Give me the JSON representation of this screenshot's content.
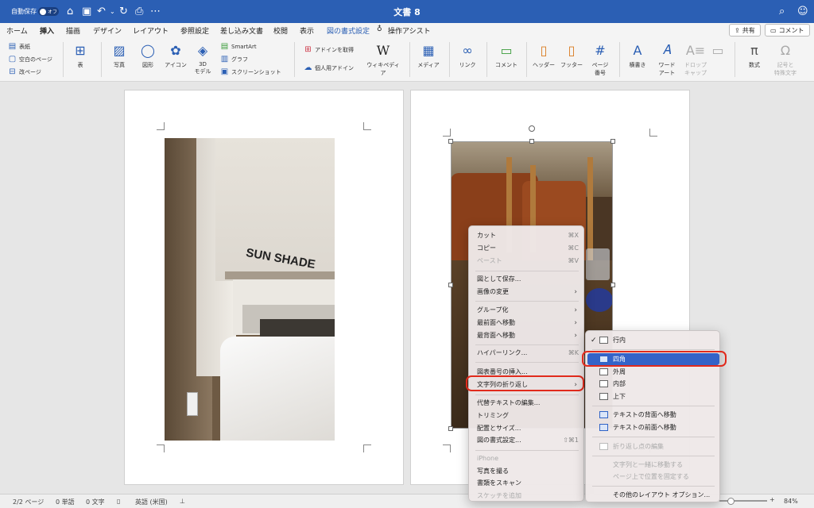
{
  "titlebar": {
    "autosave": "自動保存",
    "toggle": "オフ",
    "doc_title": "文書 8"
  },
  "tabs": [
    "ホーム",
    "挿入",
    "描画",
    "デザイン",
    "レイアウト",
    "参照設定",
    "差し込み文書",
    "校閲",
    "表示",
    "図の書式設定",
    "操作アシスト"
  ],
  "share": {
    "share_label": "共有",
    "comment_label": "コメント"
  },
  "ribbon": {
    "pages": [
      "表紙",
      "空白のページ",
      "改ページ"
    ],
    "table": "表",
    "photo": "写真",
    "shape": "図形",
    "icon": "アイコン",
    "model3d": "3D\nモデル",
    "smartart": "SmartArt",
    "graph": "グラフ",
    "screenshot": "スクリーンショット",
    "get_addin": "アドインを取得",
    "personal_addin": "個人用アドイン",
    "wikipedia": "ウィキペディア",
    "media": "メディア",
    "link": "リンク",
    "comment": "コメント",
    "header": "ヘッダー",
    "footer": "フッター",
    "page_number": "ページ\n番号",
    "textbox": "横書き",
    "wordart": "ワード\nアート",
    "dropcap": "ドロップ\nキャップ",
    "equation": "数式",
    "symbol": "記号と\n特殊文字"
  },
  "photo_left": {
    "sign_text": "SUN SHADE"
  },
  "context_menu": {
    "items": [
      {
        "label": "カット",
        "shortcut": "⌘X",
        "disabled": false
      },
      {
        "label": "コピー",
        "shortcut": "⌘C",
        "disabled": false
      },
      {
        "label": "ペースト",
        "shortcut": "⌘V",
        "disabled": true
      },
      {
        "label": "図として保存...",
        "shortcut": "",
        "disabled": false
      },
      {
        "label": "画像の変更",
        "shortcut": "",
        "disabled": false
      },
      {
        "label": "グループ化",
        "shortcut": "",
        "disabled": false
      },
      {
        "label": "最前面へ移動",
        "shortcut": "",
        "disabled": false
      },
      {
        "label": "最背面へ移動",
        "shortcut": "",
        "disabled": false
      },
      {
        "label": "ハイパーリンク...",
        "shortcut": "⌘K",
        "disabled": false
      },
      {
        "label": "図表番号の挿入...",
        "shortcut": "",
        "disabled": false
      },
      {
        "label": "文字列の折り返し",
        "shortcut": "",
        "disabled": false
      },
      {
        "label": "代替テキストの編集...",
        "shortcut": "",
        "disabled": false
      },
      {
        "label": "トリミング",
        "shortcut": "",
        "disabled": false
      },
      {
        "label": "配置とサイズ...",
        "shortcut": "",
        "disabled": false
      },
      {
        "label": "図の書式設定...",
        "shortcut": "⇧⌘1",
        "disabled": false
      },
      {
        "label": "iPhone",
        "shortcut": "",
        "disabled": true
      },
      {
        "label": "写真を撮る",
        "shortcut": "",
        "disabled": false
      },
      {
        "label": "書類をスキャン",
        "shortcut": "",
        "disabled": false
      },
      {
        "label": "スケッチを追加",
        "shortcut": "",
        "disabled": true
      }
    ]
  },
  "submenu": {
    "items": [
      {
        "label": "行内",
        "checked": true
      },
      {
        "label": "四角",
        "selected": true
      },
      {
        "label": "外周"
      },
      {
        "label": "内部"
      },
      {
        "label": "上下"
      },
      {
        "label": "テキストの背面へ移動"
      },
      {
        "label": "テキストの前面へ移動"
      },
      {
        "label": "折り返し点の編集",
        "disabled": true
      },
      {
        "label": "文字列と一緒に移動する",
        "disabled": true
      },
      {
        "label": "ページ上で位置を固定する",
        "disabled": true
      },
      {
        "label": "その他のレイアウト オプション..."
      }
    ]
  },
  "statusbar": {
    "page": "2/2 ページ",
    "words": "0 単語",
    "chars": "0 文字",
    "language": "英語 (米国)",
    "zoom": "84%"
  },
  "colors": {
    "accent": "#2b5fb4",
    "highlight_ring": "#e12a1c",
    "menu_selection": "#3463c8"
  }
}
